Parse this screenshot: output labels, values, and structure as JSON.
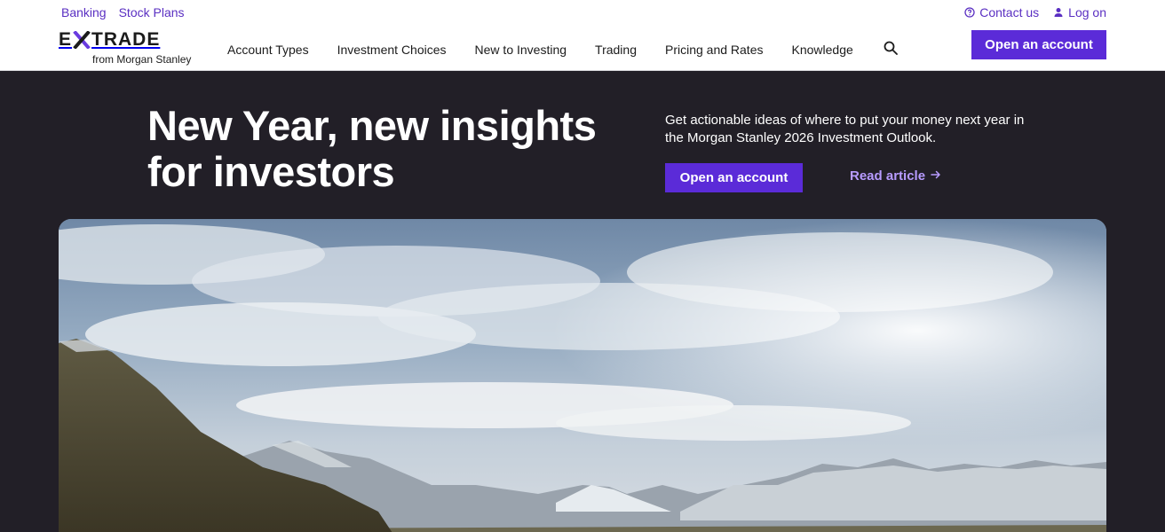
{
  "header": {
    "utility_left": [
      "Banking",
      "Stock Plans"
    ],
    "contact_label": "Contact us",
    "login_label": "Log on",
    "logo": {
      "word_left": "E",
      "word_right": "TRADE",
      "sub": "from Morgan Stanley"
    },
    "nav": [
      "Account Types",
      "Investment Choices",
      "New to Investing",
      "Trading",
      "Pricing and Rates",
      "Knowledge"
    ],
    "cta_label": "Open an account"
  },
  "hero": {
    "title": "New Year, new insights for investors",
    "text": "Get actionable ideas of where to put your money next year in the Morgan Stanley 2026 Investment Outlook.",
    "cta_label": "Open an account",
    "link_label": "Read article"
  },
  "icons": {
    "search": "search-icon",
    "contact": "help-circle-icon",
    "user": "user-icon",
    "arrow": "arrow-right-icon"
  },
  "colors": {
    "brand_purple": "#5b2bd8",
    "link_purple": "#5a2fc2",
    "hero_bg": "#221f27",
    "hero_link": "#b79bff"
  }
}
